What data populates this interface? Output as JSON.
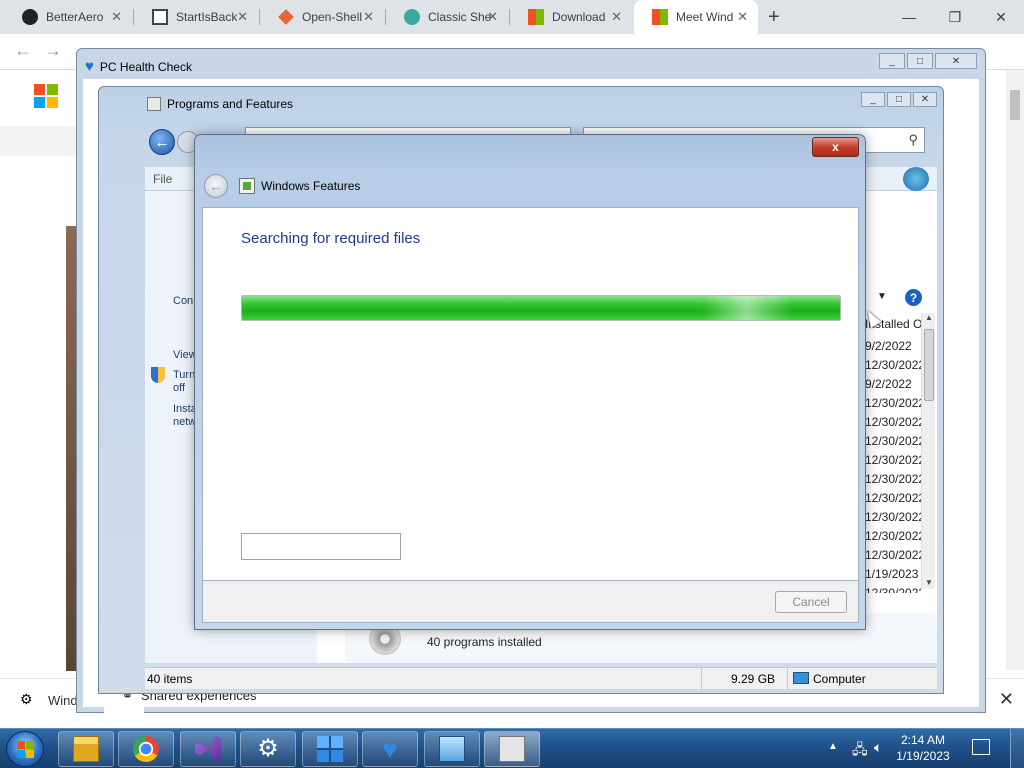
{
  "browser": {
    "tabs": [
      {
        "label": "BetterAero",
        "icon": "github-icon"
      },
      {
        "label": "StartIsBack",
        "icon": "startisback-icon"
      },
      {
        "label": "Open-Shell",
        "icon": "openshell-icon"
      },
      {
        "label": "Classic She",
        "icon": "classic-shell-icon"
      },
      {
        "label": "Download",
        "icon": "microsoft-icon"
      },
      {
        "label": "Meet Wind",
        "icon": "microsoft-icon",
        "active": true
      }
    ],
    "close_glyph": "✕",
    "new_tab_glyph": "+",
    "window_controls": {
      "minimize": "—",
      "restore": "❐",
      "close": "✕"
    },
    "bottom_banner_text": "Wind",
    "bottom_banner_close": "✕"
  },
  "pc_health_check": {
    "title": "PC Health Check",
    "shared_experiences": "Shared experiences"
  },
  "programs_features": {
    "title": "Programs and Features",
    "menu_file": "File",
    "left_links": [
      {
        "text": "Con"
      },
      {
        "text": "View"
      },
      {
        "text": "Turn\noff"
      },
      {
        "text": "Insta\nnetw"
      }
    ],
    "column_header": "Installed O",
    "dates": [
      "9/2/2022",
      "12/30/2022",
      "9/2/2022",
      "12/30/2022",
      "12/30/2022",
      "12/30/2022",
      "12/30/2022",
      "12/30/2022",
      "12/30/2022",
      "12/30/2022",
      "12/30/2022",
      "12/30/2022",
      "1/19/2023",
      "12/30/2022"
    ],
    "programs_installed": "40 programs installed",
    "status_items": "40 items",
    "status_size": "9.29 GB",
    "status_location": "Computer",
    "help_glyph": "?"
  },
  "windows_features": {
    "title": "Windows Features",
    "heading": "Searching for required files",
    "progress_fraction": 1.0,
    "cancel_label": "Cancel",
    "close_glyph": "x"
  },
  "taskbar": {
    "time": "2:14 AM",
    "date": "1/19/2023",
    "tray_up_glyph": "▲",
    "pinned": [
      "file-explorer-icon",
      "chrome-icon",
      "visual-studio-icon",
      "settings-gear-icon",
      "windows-logo-icon",
      "pc-health-check-icon",
      "control-panel-icon",
      "programs-installer-icon"
    ]
  },
  "colors": {
    "progress_green": "#1bb01b",
    "heading_blue": "#1e3b87",
    "taskbar_blue": "#1f4f86"
  }
}
